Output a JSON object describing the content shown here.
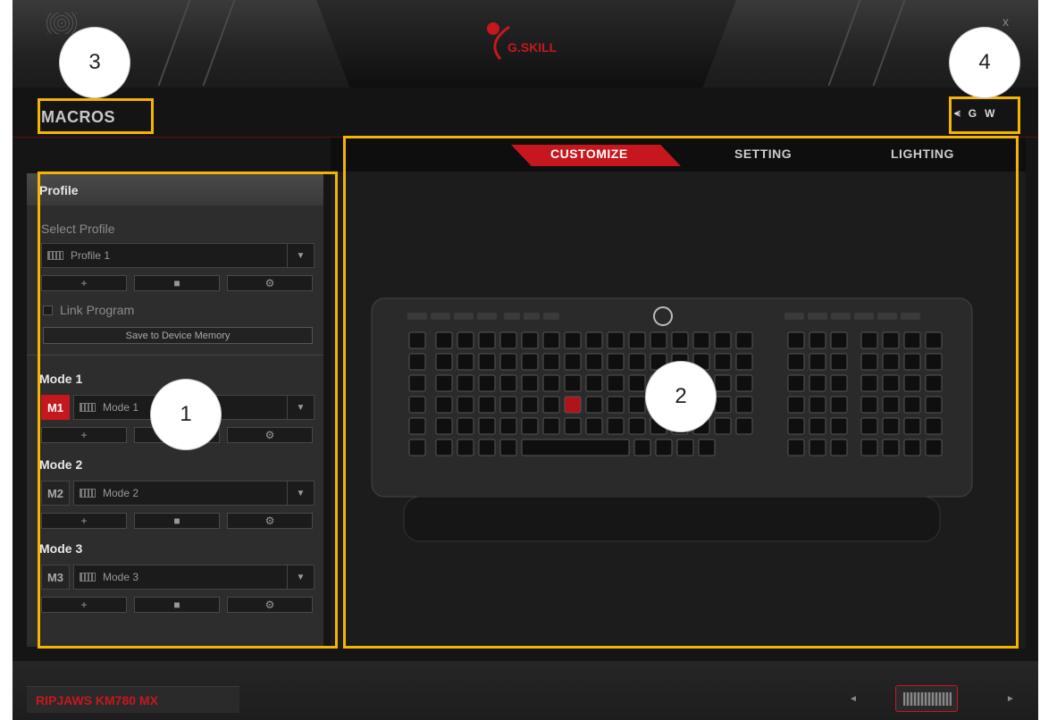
{
  "app": {
    "brand": "G.SKILL",
    "close_glyph": "x"
  },
  "header": {
    "title": "MACROS",
    "icons": [
      {
        "name": "usb-icon",
        "glyph": "⪪"
      },
      {
        "name": "g-icon",
        "glyph": "G"
      },
      {
        "name": "w-icon",
        "glyph": "W"
      }
    ]
  },
  "tabs": [
    {
      "label": "CUSTOMIZE",
      "active": true
    },
    {
      "label": "SETTING",
      "active": false
    },
    {
      "label": "LIGHTING",
      "active": false
    }
  ],
  "sidebar": {
    "section_title": "Profile",
    "select_profile_label": "Select Profile",
    "profile_value": "Profile 1",
    "link_program_label": "Link Program",
    "save_button": "Save to Device Memory",
    "buttons": {
      "add": "+",
      "delete": "■",
      "settings": "⚙"
    },
    "modes": [
      {
        "heading": "Mode 1",
        "badge": "M1",
        "value": "Mode 1",
        "active": true
      },
      {
        "heading": "Mode 2",
        "badge": "M2",
        "value": "Mode 2",
        "active": false
      },
      {
        "heading": "Mode 3",
        "badge": "M3",
        "value": "Mode 3",
        "active": false
      }
    ]
  },
  "footer": {
    "model": "RIPJAWS KM780 MX",
    "prev": "◄",
    "next": "►"
  },
  "annotations": [
    {
      "label": "3"
    },
    {
      "label": "4"
    },
    {
      "label": "1"
    },
    {
      "label": "2"
    }
  ],
  "colors": {
    "accent": "#c7171e",
    "highlight": "#f4b400"
  }
}
